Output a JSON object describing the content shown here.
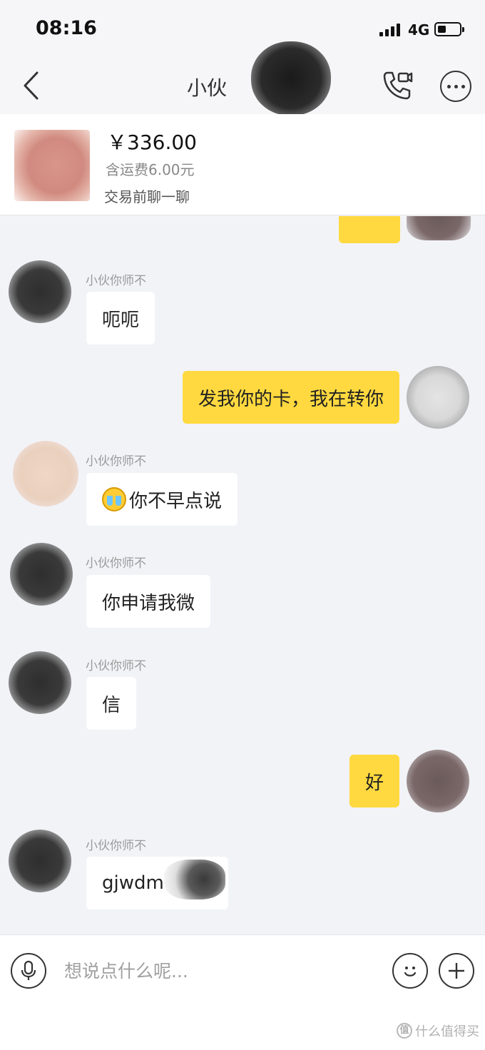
{
  "status_bar": {
    "time": "08:16",
    "network": "4G"
  },
  "nav": {
    "title": "小伙"
  },
  "product": {
    "price": "￥336.00",
    "shipping": "含运费6.00元",
    "subtitle": "交易前聊一聊"
  },
  "messages": [
    {
      "direction": "in",
      "sender": "小伙你师不",
      "text": "呃呃"
    },
    {
      "direction": "out",
      "text": "发我你的卡，我在转你"
    },
    {
      "direction": "in",
      "sender": "小伙你师不",
      "text": "你不早点说"
    },
    {
      "direction": "in",
      "sender": "小伙你师不",
      "text": "你申请我微"
    },
    {
      "direction": "in",
      "sender": "小伙你师不",
      "text": "信"
    },
    {
      "direction": "out",
      "text": "好"
    },
    {
      "direction": "in",
      "sender": "小伙你师不",
      "text": "gjwdm"
    }
  ],
  "input": {
    "placeholder": "想说点什么呢..."
  },
  "watermark": {
    "badge": "值",
    "text": "什么值得买"
  },
  "colors": {
    "outgoing_bubble": "#ffd93f",
    "incoming_bubble": "#ffffff",
    "background": "#f2f3f7"
  }
}
